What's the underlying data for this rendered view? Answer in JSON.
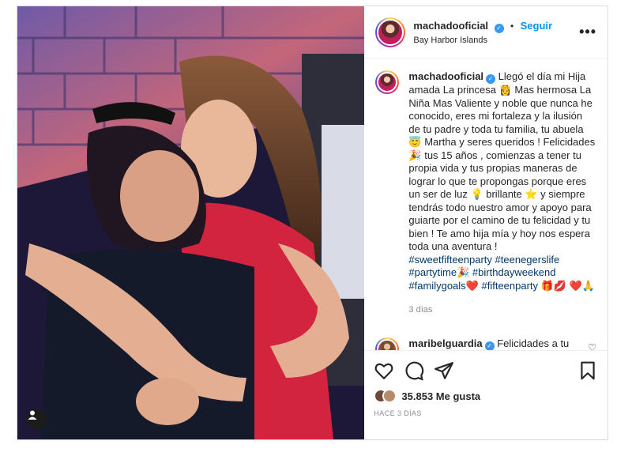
{
  "post": {
    "username": "machadooficial",
    "follow_label": "Seguir",
    "separator": "•",
    "location": "Bay Harbor Islands",
    "more_label": "•••"
  },
  "caption": {
    "username": "machadooficial",
    "text": "Llegó el día mi Hija amada La princesa 👸 Mas hermosa La Niña Mas Valiente y noble que nunca he conocido, eres mi fortaleza y la ilusión de tu padre y toda tu familia, tu abuela 😇 Martha y seres queridos ! Felicidades 🎉 tus 15 años , comienzas a tener tu propia vida y tus propias maneras de lograr lo que te propongas porque eres un ser de luz 💡 brillante ⭐ y siempre tendrás todo nuestro amor y apoyo para guiarte por el camino de tu felicidad y tu bien ! Te amo hija mía y hoy nos espera toda una aventura !",
    "hashtags": [
      {
        "tag": "#sweetfifteenparty",
        "after": " "
      },
      {
        "tag": "#teenegerslife",
        "after": " "
      },
      {
        "tag": "#partytime",
        "after": "🎉 "
      },
      {
        "tag": "#birthdayweekend",
        "after": " "
      },
      {
        "tag": "#familygoals",
        "after": "❤️ "
      },
      {
        "tag": "#fifteenparty",
        "after": " 🎁💋 ❤️🙏"
      }
    ],
    "time_ago": "3 días"
  },
  "comment": {
    "username": "maribelguardia",
    "text": "Felicidades a tu princesa 👑🎉🎂🎊🎈"
  },
  "likes": {
    "count_label": "35.853 Me gusta"
  },
  "date_label": "HACE 3 DÍAS",
  "icons": {
    "like": "heart-icon",
    "comment": "comment-icon",
    "share": "share-icon",
    "save": "bookmark-icon",
    "tag": "user-tag-icon",
    "options": "more-options-icon"
  },
  "colors": {
    "link": "#00376b",
    "follow": "#0095f6",
    "verified": "#3897f0",
    "muted": "#8e8e8e"
  }
}
